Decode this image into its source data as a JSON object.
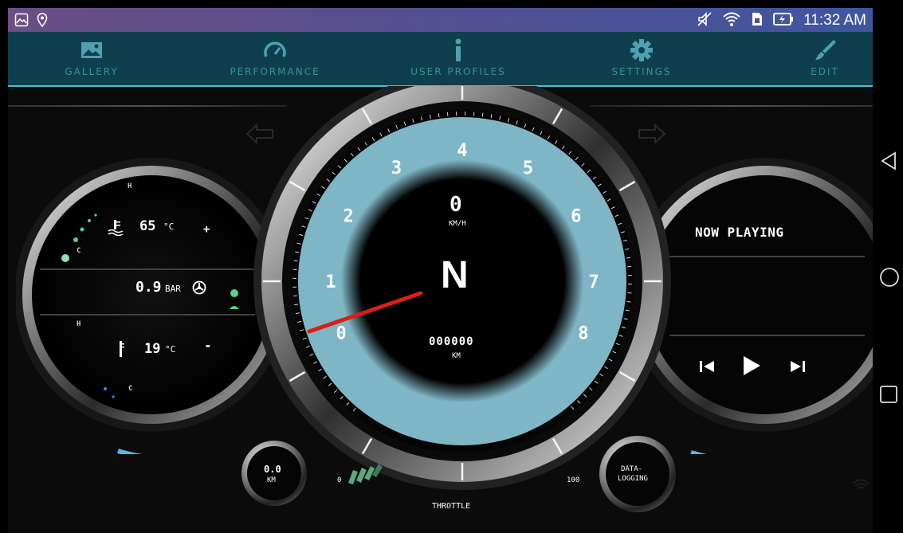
{
  "status_bar": {
    "time": "11:32 AM",
    "icons_left": [
      "gallery-notification-icon",
      "location-icon"
    ],
    "icons_right": [
      "mute-icon",
      "wifi-icon",
      "sim-icon",
      "battery-charging-icon"
    ]
  },
  "nav": {
    "items": [
      {
        "label": "GALLERY",
        "icon": "image-icon"
      },
      {
        "label": "PERFORMANCE",
        "icon": "gauge-icon"
      },
      {
        "label": "USER PROFILES",
        "icon": "info-icon"
      },
      {
        "label": "SETTINGS",
        "icon": "gear-icon"
      },
      {
        "label": "EDIT",
        "icon": "brush-icon"
      }
    ],
    "accent_color": "#43c1d0",
    "bar_color": "#0f3f4d"
  },
  "left_gauge": {
    "coolant_temp": "65",
    "coolant_unit": "°C",
    "coolant_hot": "H",
    "coolant_cold": "C",
    "plus": "+",
    "boost": "0.9",
    "boost_unit": "BAR",
    "air_temp": "19",
    "air_unit": "°C",
    "air_hot": "H",
    "air_cold": "C",
    "minus": "-"
  },
  "center_gauge": {
    "rpm_ticks": [
      "0",
      "1",
      "2",
      "3",
      "4",
      "5",
      "6",
      "7",
      "8"
    ],
    "speed": "0",
    "speed_unit": "KM/H",
    "gear": "N",
    "odometer": "000000",
    "odometer_unit": "KM",
    "ring_color": "#7fb6c6",
    "needle_color": "#d81f16"
  },
  "trip": {
    "value": "0.0",
    "unit": "KM"
  },
  "throttle": {
    "label": "THROTTLE",
    "min": "0",
    "max": "100"
  },
  "data_logging": {
    "label_line1": "DATA-",
    "label_line2": "LOGGING"
  },
  "media": {
    "title": "NOW PLAYING"
  },
  "system_nav": [
    "back-icon",
    "home-icon",
    "recents-icon"
  ]
}
